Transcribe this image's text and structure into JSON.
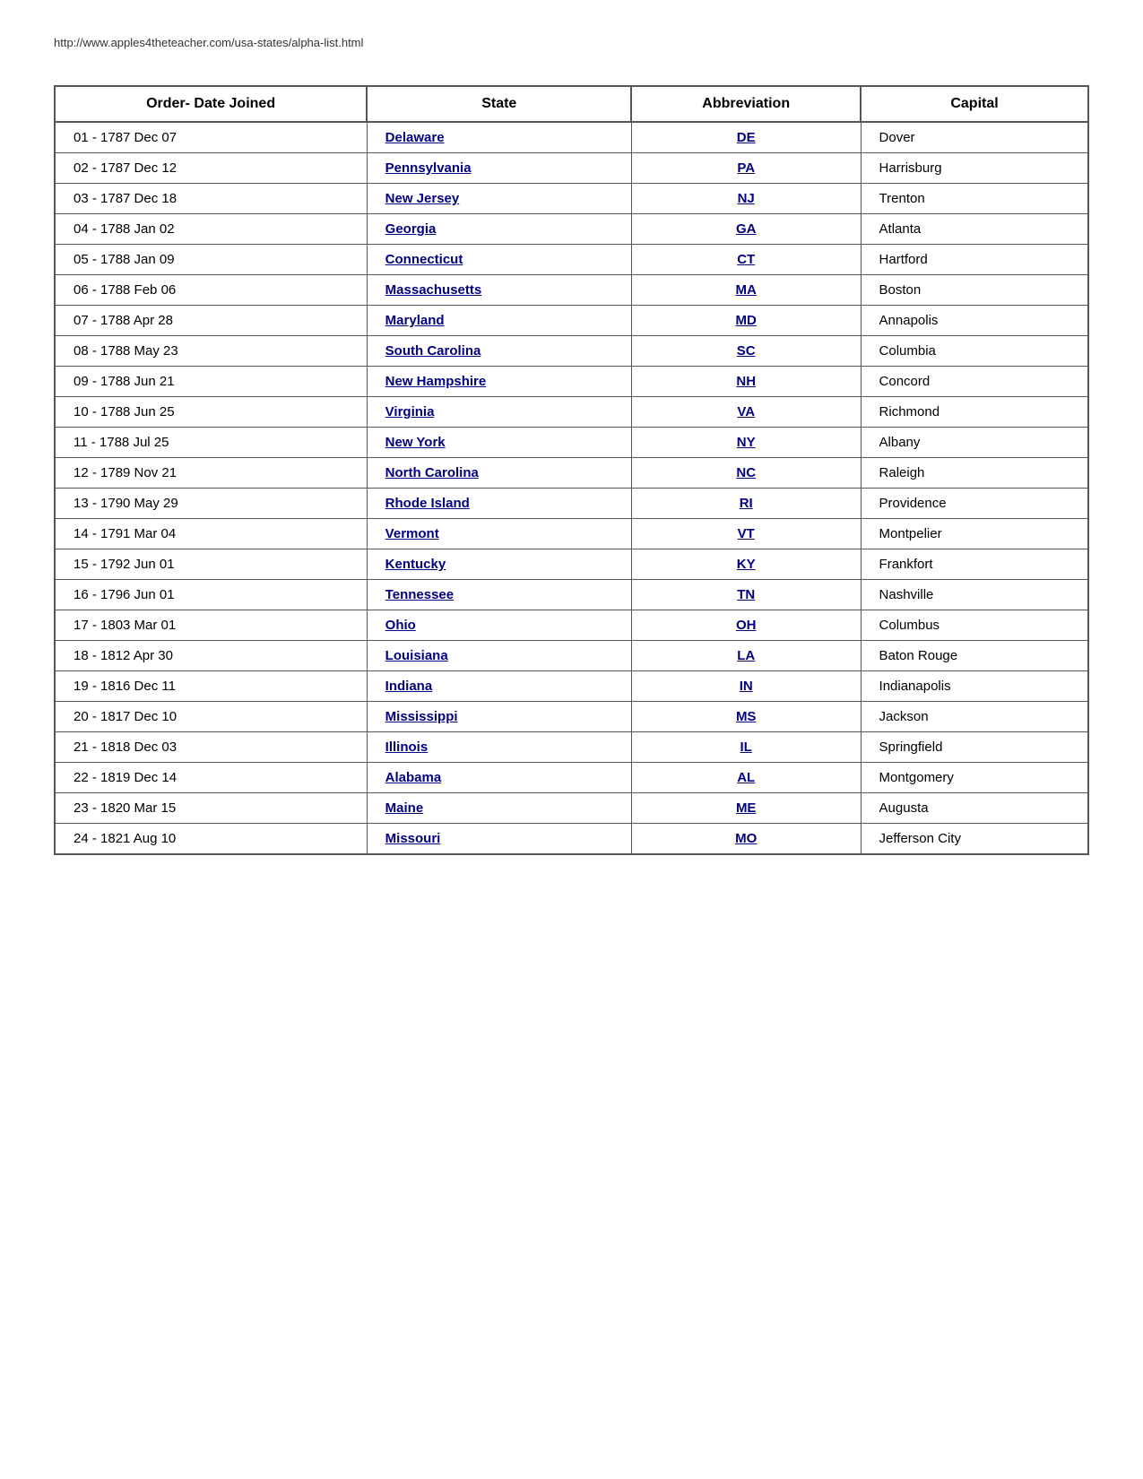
{
  "url": "http://www.apples4theteacher.com/usa-states/alpha-list.html",
  "columns": {
    "order": "Order- Date Joined",
    "state": "State",
    "abbreviation": "Abbreviation",
    "capital": "Capital"
  },
  "rows": [
    {
      "order": "01 - 1787 Dec 07",
      "state": "Delaware",
      "abbr": "DE",
      "capital": "Dover"
    },
    {
      "order": "02 - 1787 Dec 12",
      "state": "Pennsylvania",
      "abbr": "PA",
      "capital": "Harrisburg"
    },
    {
      "order": "03 - 1787 Dec 18",
      "state": "New Jersey",
      "abbr": "NJ",
      "capital": "Trenton"
    },
    {
      "order": "04 - 1788 Jan 02",
      "state": "Georgia",
      "abbr": "GA",
      "capital": "Atlanta"
    },
    {
      "order": "05 - 1788 Jan 09",
      "state": "Connecticut",
      "abbr": "CT",
      "capital": "Hartford"
    },
    {
      "order": "06 - 1788 Feb 06",
      "state": "Massachusetts",
      "abbr": "MA",
      "capital": "Boston"
    },
    {
      "order": "07 - 1788 Apr 28",
      "state": "Maryland",
      "abbr": "MD",
      "capital": "Annapolis"
    },
    {
      "order": "08 - 1788 May 23",
      "state": "South Carolina",
      "abbr": "SC",
      "capital": "Columbia"
    },
    {
      "order": "09 - 1788 Jun 21",
      "state": "New Hampshire",
      "abbr": "NH",
      "capital": "Concord"
    },
    {
      "order": "10 - 1788 Jun 25",
      "state": "Virginia",
      "abbr": "VA",
      "capital": "Richmond"
    },
    {
      "order": "11 - 1788 Jul 25",
      "state": "New York",
      "abbr": "NY",
      "capital": "Albany"
    },
    {
      "order": "12 - 1789 Nov 21",
      "state": "North Carolina",
      "abbr": "NC",
      "capital": "Raleigh"
    },
    {
      "order": "13 - 1790 May 29",
      "state": "Rhode Island",
      "abbr": "RI",
      "capital": "Providence"
    },
    {
      "order": "14 - 1791 Mar 04",
      "state": "Vermont",
      "abbr": "VT",
      "capital": "Montpelier"
    },
    {
      "order": "15 - 1792 Jun 01",
      "state": "Kentucky",
      "abbr": "KY",
      "capital": "Frankfort"
    },
    {
      "order": "16 - 1796 Jun 01",
      "state": "Tennessee",
      "abbr": "TN",
      "capital": "Nashville"
    },
    {
      "order": "17 - 1803 Mar 01",
      "state": "Ohio",
      "abbr": "OH",
      "capital": "Columbus"
    },
    {
      "order": "18 - 1812 Apr 30",
      "state": "Louisiana",
      "abbr": "LA",
      "capital": "Baton Rouge"
    },
    {
      "order": "19 - 1816 Dec 11",
      "state": "Indiana",
      "abbr": "IN",
      "capital": "Indianapolis"
    },
    {
      "order": "20 - 1817 Dec 10",
      "state": "Mississippi",
      "abbr": "MS",
      "capital": "Jackson"
    },
    {
      "order": "21 - 1818 Dec 03",
      "state": "Illinois",
      "abbr": "IL",
      "capital": "Springfield"
    },
    {
      "order": "22 - 1819 Dec 14",
      "state": "Alabama",
      "abbr": "AL",
      "capital": "Montgomery"
    },
    {
      "order": "23 - 1820 Mar 15",
      "state": "Maine",
      "abbr": "ME",
      "capital": "Augusta"
    },
    {
      "order": "24 - 1821 Aug 10",
      "state": "Missouri",
      "abbr": "MO",
      "capital": "Jefferson City"
    }
  ]
}
